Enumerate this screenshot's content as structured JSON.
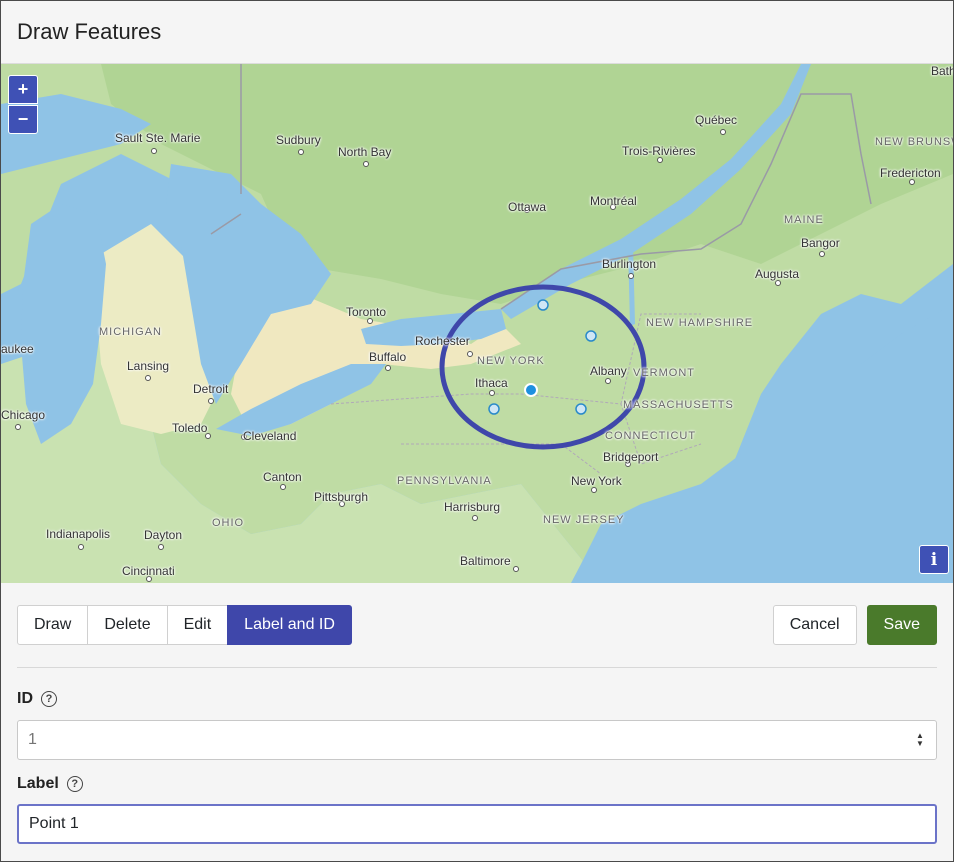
{
  "header": {
    "title": "Draw Features"
  },
  "map": {
    "zoom_in": "+",
    "zoom_out": "−",
    "info": "i",
    "regions": [
      "MICHIGAN",
      "NEW YORK",
      "VERMONT",
      "NEW HAMPSHIRE",
      "MAINE",
      "NEW BRUNSW",
      "MASSACHUSETTS",
      "CONNECTICUT",
      "PENNSYLVANIA",
      "NEW JERSEY",
      "OHIO"
    ],
    "cities": [
      "Sault Ste. Marie",
      "Sudbury",
      "North Bay",
      "Québec",
      "Trois-Rivières",
      "Fredericton",
      "Bath",
      "Ottawa",
      "Montréal",
      "Bangor",
      "Burlington",
      "Augusta",
      "Toronto",
      "Rochester",
      "Buffalo",
      "Albany",
      "Ithaca",
      "Lansing",
      "Detroit",
      "Toledo",
      "Cleveland",
      "aukee",
      "Chicago",
      "Bridgeport",
      "New York",
      "Canton",
      "Pittsburgh",
      "Harrisburg",
      "Indianapolis",
      "Dayton",
      "Cincinnati",
      "Baltimore"
    ],
    "accent_color": "#3f47aa"
  },
  "toolbar": {
    "modes": [
      "Draw",
      "Delete",
      "Edit",
      "Label and ID"
    ],
    "active_mode": "Label and ID",
    "cancel_label": "Cancel",
    "save_label": "Save"
  },
  "form": {
    "id_label": "ID",
    "id_placeholder": "1",
    "label_label": "Label",
    "label_value": "Point 1",
    "help_glyph": "?"
  }
}
